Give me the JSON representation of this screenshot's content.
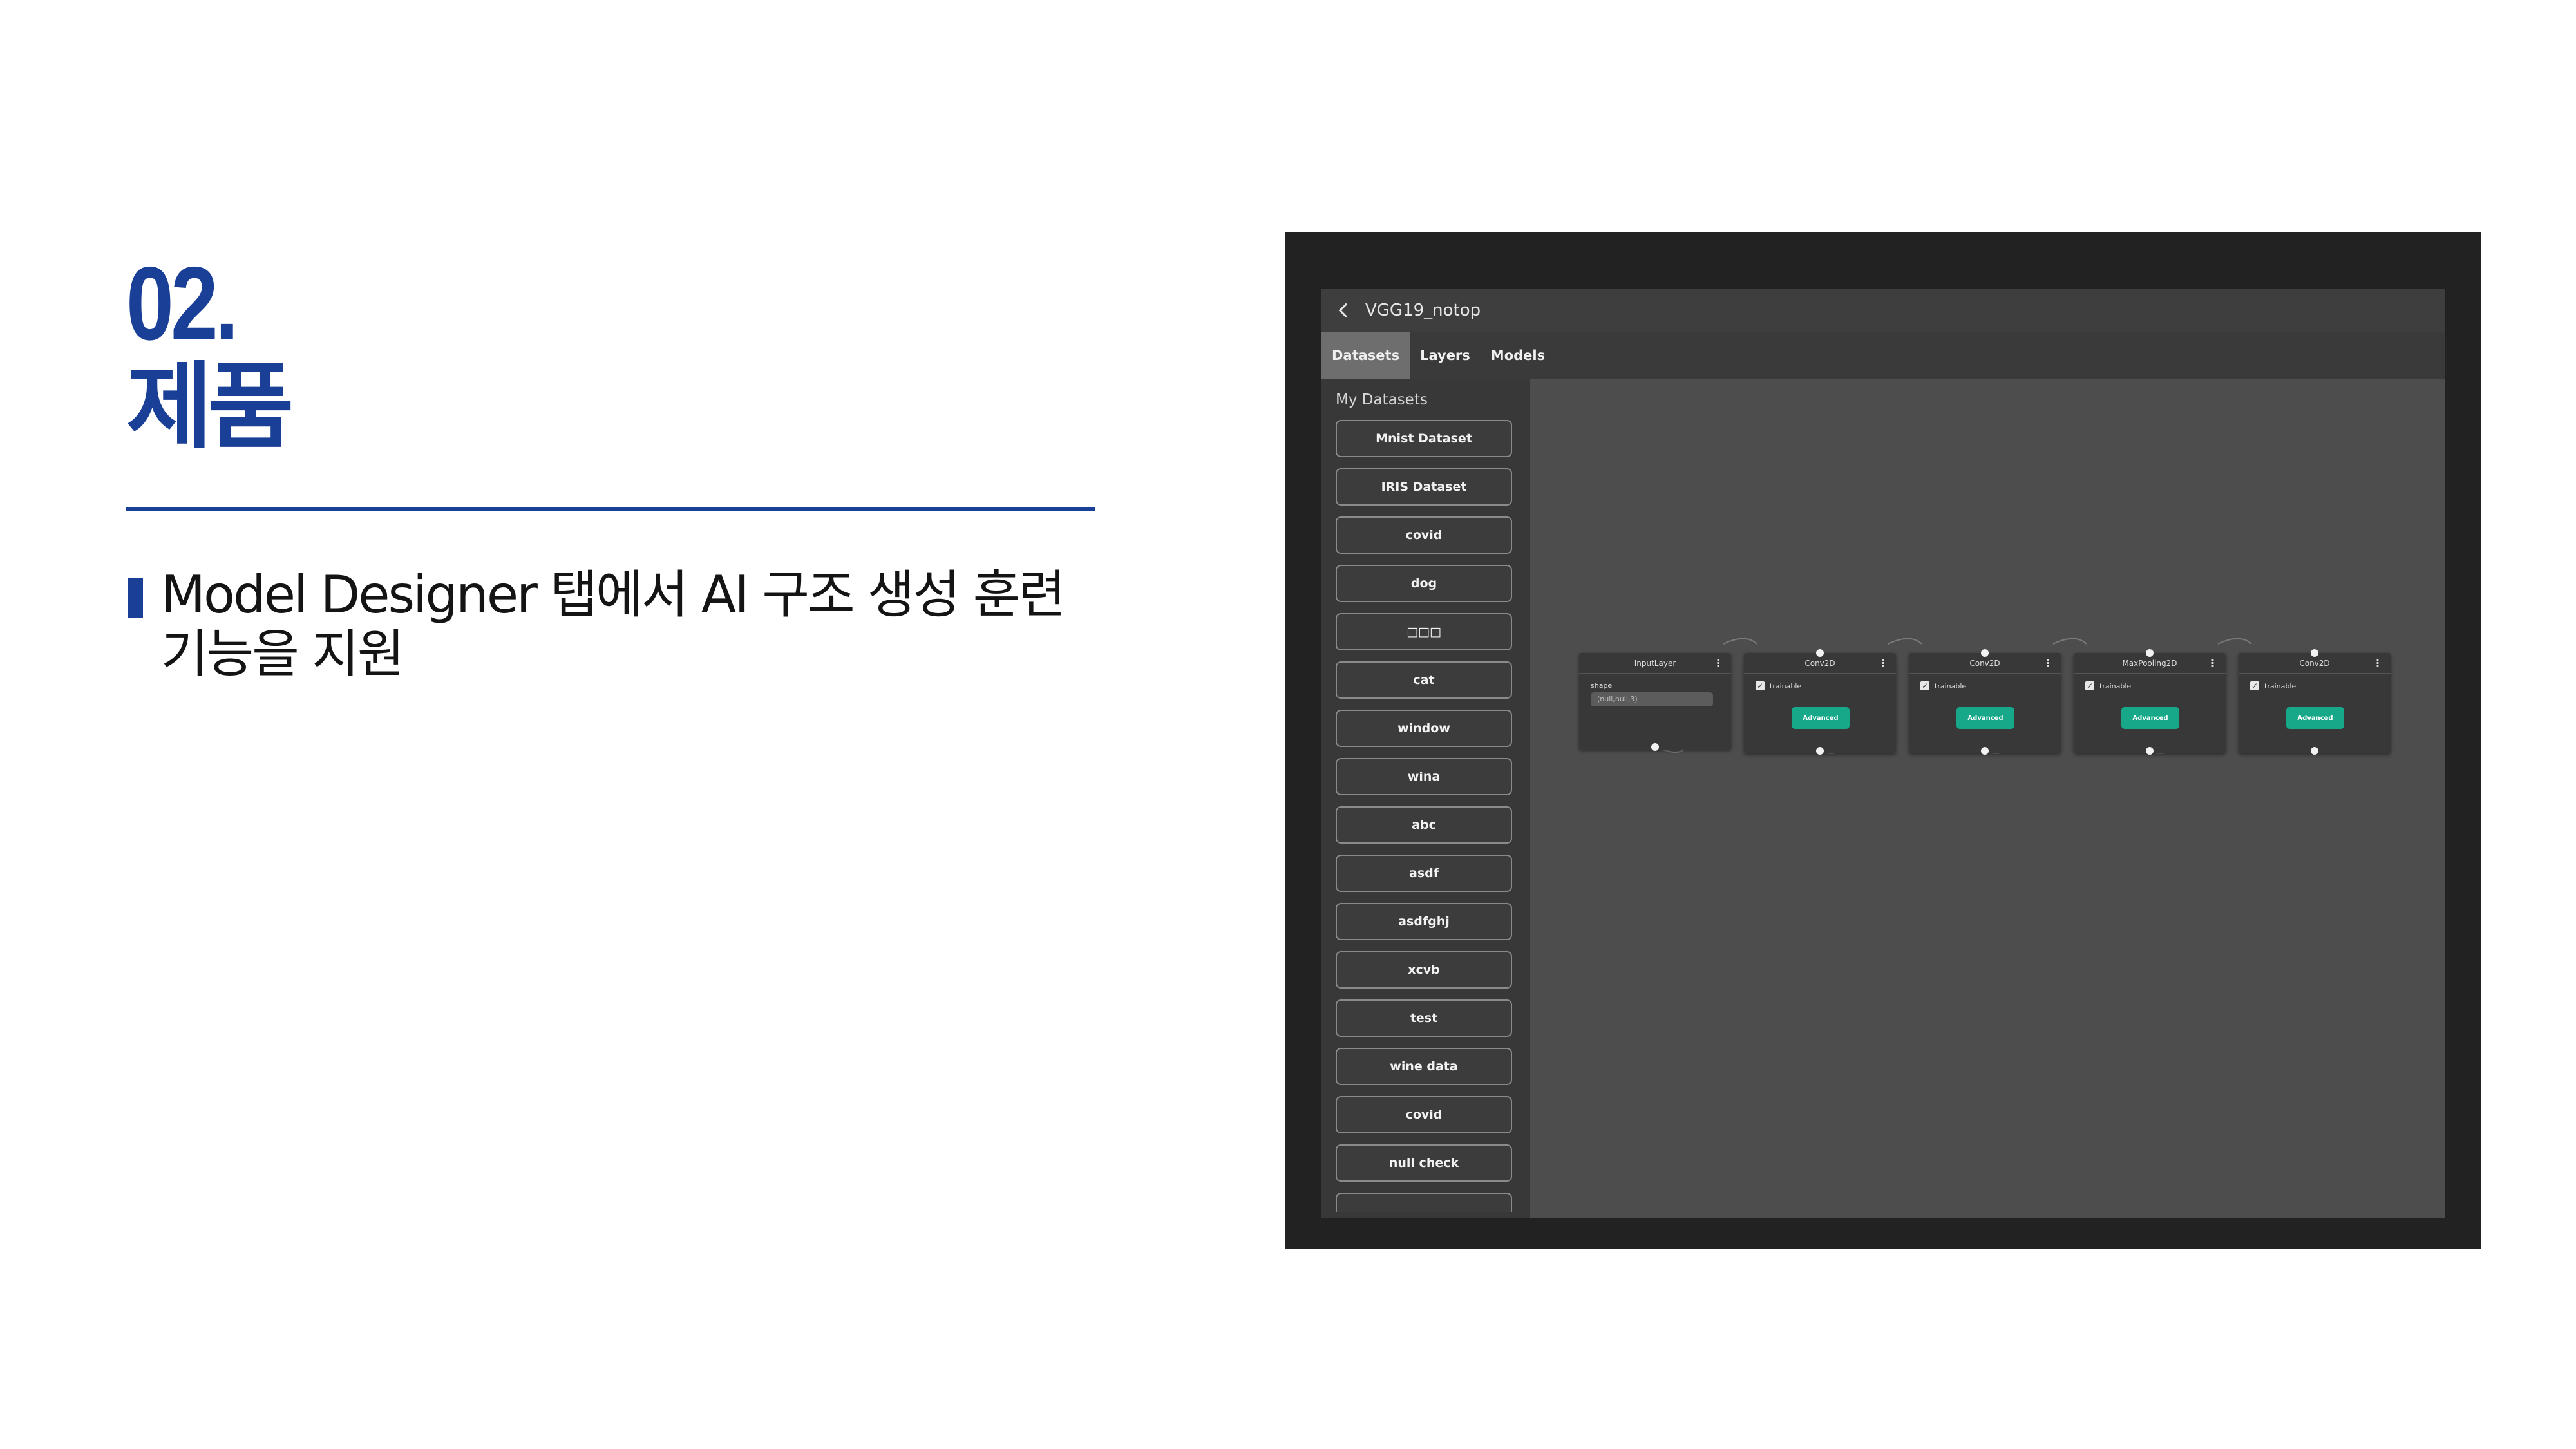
{
  "slide": {
    "number": "02.",
    "title": "제품",
    "bullet_line1": "Model Designer 탭에서 AI 구조 생성 훈련",
    "bullet_line2": "기능을 지원",
    "accent_color": "#1a3f96"
  },
  "app": {
    "project_title": "VGG19_notop",
    "tabs": [
      "Datasets",
      "Layers",
      "Models"
    ],
    "active_tab": "Datasets",
    "sidebar_heading": "My Datasets",
    "datasets": [
      "Mnist Dataset",
      "IRIS Dataset",
      "covid",
      "dog",
      "□□□",
      "cat",
      "window",
      "wina",
      "abc",
      "asdf",
      "asdfghj",
      "xcvb",
      "test",
      "wine data",
      "covid",
      "null check"
    ],
    "nodes": [
      {
        "title": "InputLayer",
        "field_label": "shape",
        "field_value": "(null,null,3)"
      },
      {
        "title": "Conv2D",
        "checkbox_label": "trainable",
        "button_label": "Advanced"
      },
      {
        "title": "Conv2D",
        "checkbox_label": "trainable",
        "button_label": "Advanced"
      },
      {
        "title": "MaxPooling2D",
        "checkbox_label": "trainable",
        "button_label": "Advanced"
      },
      {
        "title": "Conv2D",
        "checkbox_label": "trainable",
        "button_label": "Advanced"
      }
    ],
    "menu_glyph": "⋮",
    "check_glyph": "✓",
    "icons": {
      "back": "chevron-left-icon",
      "menu": "more-vertical-icon",
      "check": "check-icon"
    },
    "colors": {
      "advanced_button": "#17a88a",
      "active_tab": "#6e6e6e"
    }
  }
}
